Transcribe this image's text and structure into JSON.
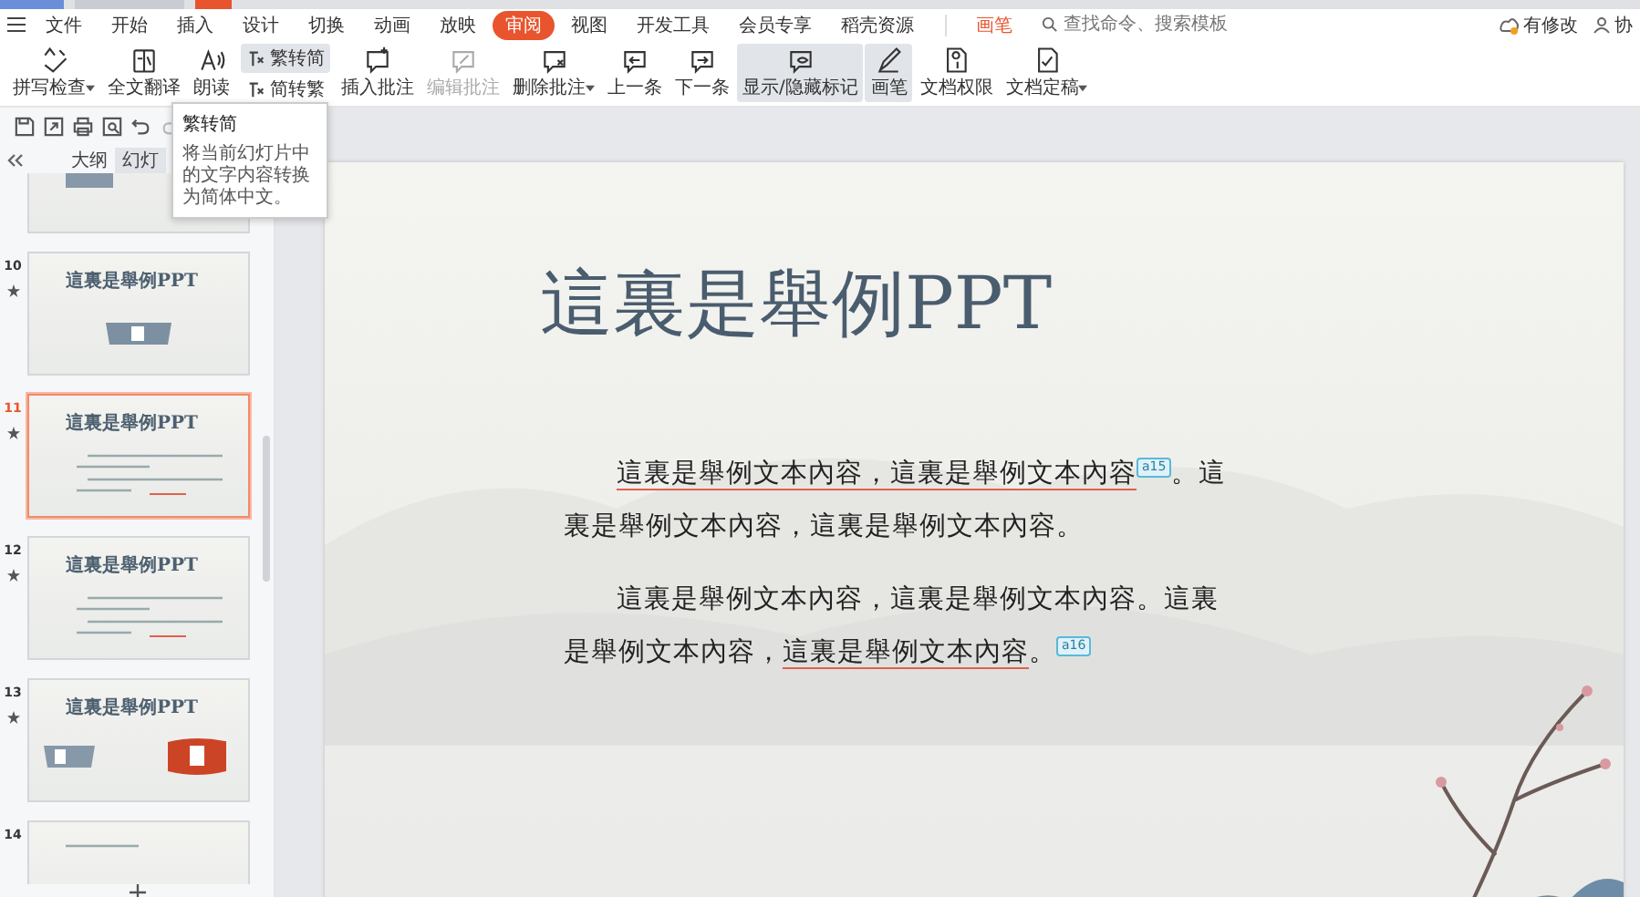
{
  "menu": {
    "items": [
      {
        "label": "文件",
        "selected": false
      },
      {
        "label": "开始",
        "selected": false
      },
      {
        "label": "插入",
        "selected": false
      },
      {
        "label": "设计",
        "selected": false
      },
      {
        "label": "切换",
        "selected": false
      },
      {
        "label": "动画",
        "selected": false
      },
      {
        "label": "放映",
        "selected": false
      },
      {
        "label": "审阅",
        "selected": true
      },
      {
        "label": "视图",
        "selected": false
      },
      {
        "label": "开发工具",
        "selected": false
      },
      {
        "label": "会员专享",
        "selected": false
      },
      {
        "label": "稻壳资源",
        "selected": false
      }
    ],
    "pen": "画笔",
    "search": {
      "placeholder": "查找命令、搜索模板"
    },
    "status": "有修改",
    "share": "协"
  },
  "ribbon": [
    {
      "label": "拼写检查",
      "dropdown": true,
      "kind": "large",
      "highlighted": false,
      "disabled": false
    },
    {
      "label": "全文翻译",
      "dropdown": false,
      "kind": "large",
      "highlighted": false,
      "disabled": false
    },
    {
      "label": "朗读",
      "dropdown": false,
      "kind": "large",
      "highlighted": false,
      "disabled": false
    },
    {
      "kind": "stack",
      "items": [
        {
          "label": "繁转简",
          "highlighted": true
        },
        {
          "label": "简转繁",
          "highlighted": false
        }
      ]
    },
    {
      "label": "插入批注",
      "dropdown": false,
      "kind": "large",
      "highlighted": false,
      "disabled": false
    },
    {
      "label": "编辑批注",
      "dropdown": false,
      "kind": "large",
      "highlighted": false,
      "disabled": true
    },
    {
      "label": "删除批注",
      "dropdown": true,
      "kind": "large",
      "highlighted": false,
      "disabled": false
    },
    {
      "label": "上一条",
      "dropdown": false,
      "kind": "large",
      "highlighted": false,
      "disabled": false
    },
    {
      "label": "下一条",
      "dropdown": false,
      "kind": "large",
      "highlighted": false,
      "disabled": false
    },
    {
      "label": "显示/隐藏标记",
      "dropdown": false,
      "kind": "large",
      "highlighted": true,
      "disabled": false
    },
    {
      "label": "画笔",
      "dropdown": false,
      "kind": "large",
      "highlighted": true,
      "disabled": false
    },
    {
      "label": "文档权限",
      "dropdown": false,
      "kind": "large",
      "highlighted": false,
      "disabled": false
    },
    {
      "label": "文档定稿",
      "dropdown": true,
      "kind": "large",
      "highlighted": false,
      "disabled": false
    }
  ],
  "tooltip": {
    "title": "繁转简",
    "text": "将当前幻灯片中的文字内容转换为简体中文。"
  },
  "panel": {
    "tabs": [
      {
        "label": "大纲",
        "selected": false
      },
      {
        "label": "幻灯",
        "selected": true
      }
    ],
    "thumbnails": [
      {
        "kind": "icons",
        "selected": false,
        "animated": false
      },
      {
        "number": "10",
        "kind": "title-icon",
        "title": "這裏是舉例PPT",
        "selected": false,
        "animated": true
      },
      {
        "number": "11",
        "kind": "title-text",
        "title": "這裏是舉例PPT",
        "selected": true,
        "animated": true
      },
      {
        "number": "12",
        "kind": "title-text",
        "title": "這裏是舉例PPT",
        "selected": false,
        "animated": true
      },
      {
        "number": "13",
        "kind": "title-ppt",
        "title": "這裏是舉例PPT",
        "selected": false,
        "animated": true
      },
      {
        "number": "14",
        "kind": "text",
        "selected": false,
        "animated": false
      }
    ]
  },
  "slide": {
    "title": "這裏是舉例PPT",
    "paragraphs": [
      [
        {
          "kind": "text",
          "text": "這裏是舉例文本內容，這裏是舉例文本內容",
          "underlined": true
        },
        {
          "kind": "comment",
          "text": "a15"
        },
        {
          "kind": "text",
          "text": "。這裏是舉例文本內容，這裏是舉例文本內容。",
          "underlined": false
        }
      ],
      [
        {
          "kind": "text",
          "text": "這裏是舉例文本內容，這裏是舉例文本內容。這裏是舉例文本內容，",
          "underlined": false
        },
        {
          "kind": "text",
          "text": "這裏是舉例文本內容",
          "underlined": true
        },
        {
          "kind": "text",
          "text": "。",
          "underlined": false
        },
        {
          "kind": "comment",
          "text": "a16"
        }
      ]
    ]
  }
}
